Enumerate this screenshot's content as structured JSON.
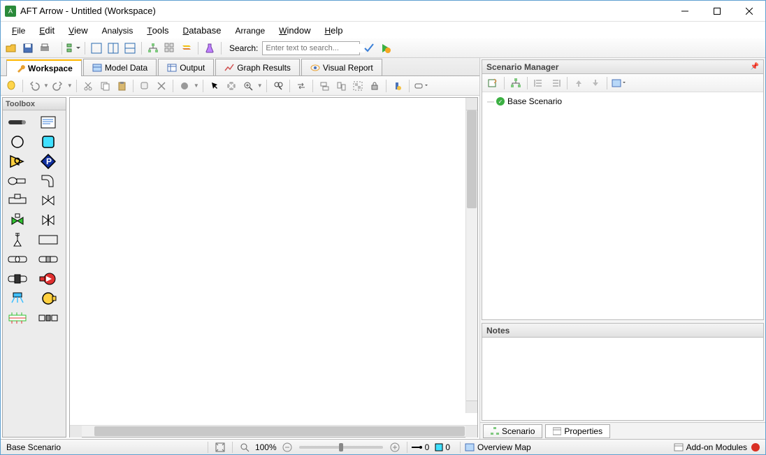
{
  "window": {
    "title": "AFT Arrow - Untitled (Workspace)"
  },
  "menu": {
    "file": "File",
    "edit": "Edit",
    "view": "View",
    "analysis": "Analysis",
    "tools": "Tools",
    "database": "Database",
    "arrange": "Arrange",
    "window": "Window",
    "help": "Help"
  },
  "toolbar": {
    "search_label": "Search:",
    "search_placeholder": "Enter text to search..."
  },
  "tabs": {
    "workspace": "Workspace",
    "model_data": "Model Data",
    "output": "Output",
    "graph_results": "Graph Results",
    "visual_report": "Visual Report"
  },
  "toolbox": {
    "title": "Toolbox"
  },
  "scenario_manager": {
    "title": "Scenario Manager",
    "base_scenario": "Base Scenario"
  },
  "notes": {
    "title": "Notes"
  },
  "bottom_tabs": {
    "scenario": "Scenario",
    "properties": "Properties"
  },
  "status": {
    "scenario": "Base Scenario",
    "zoom": "100%",
    "count1": "0",
    "count2": "0",
    "overview_map": "Overview Map",
    "addon_modules": "Add-on Modules"
  }
}
